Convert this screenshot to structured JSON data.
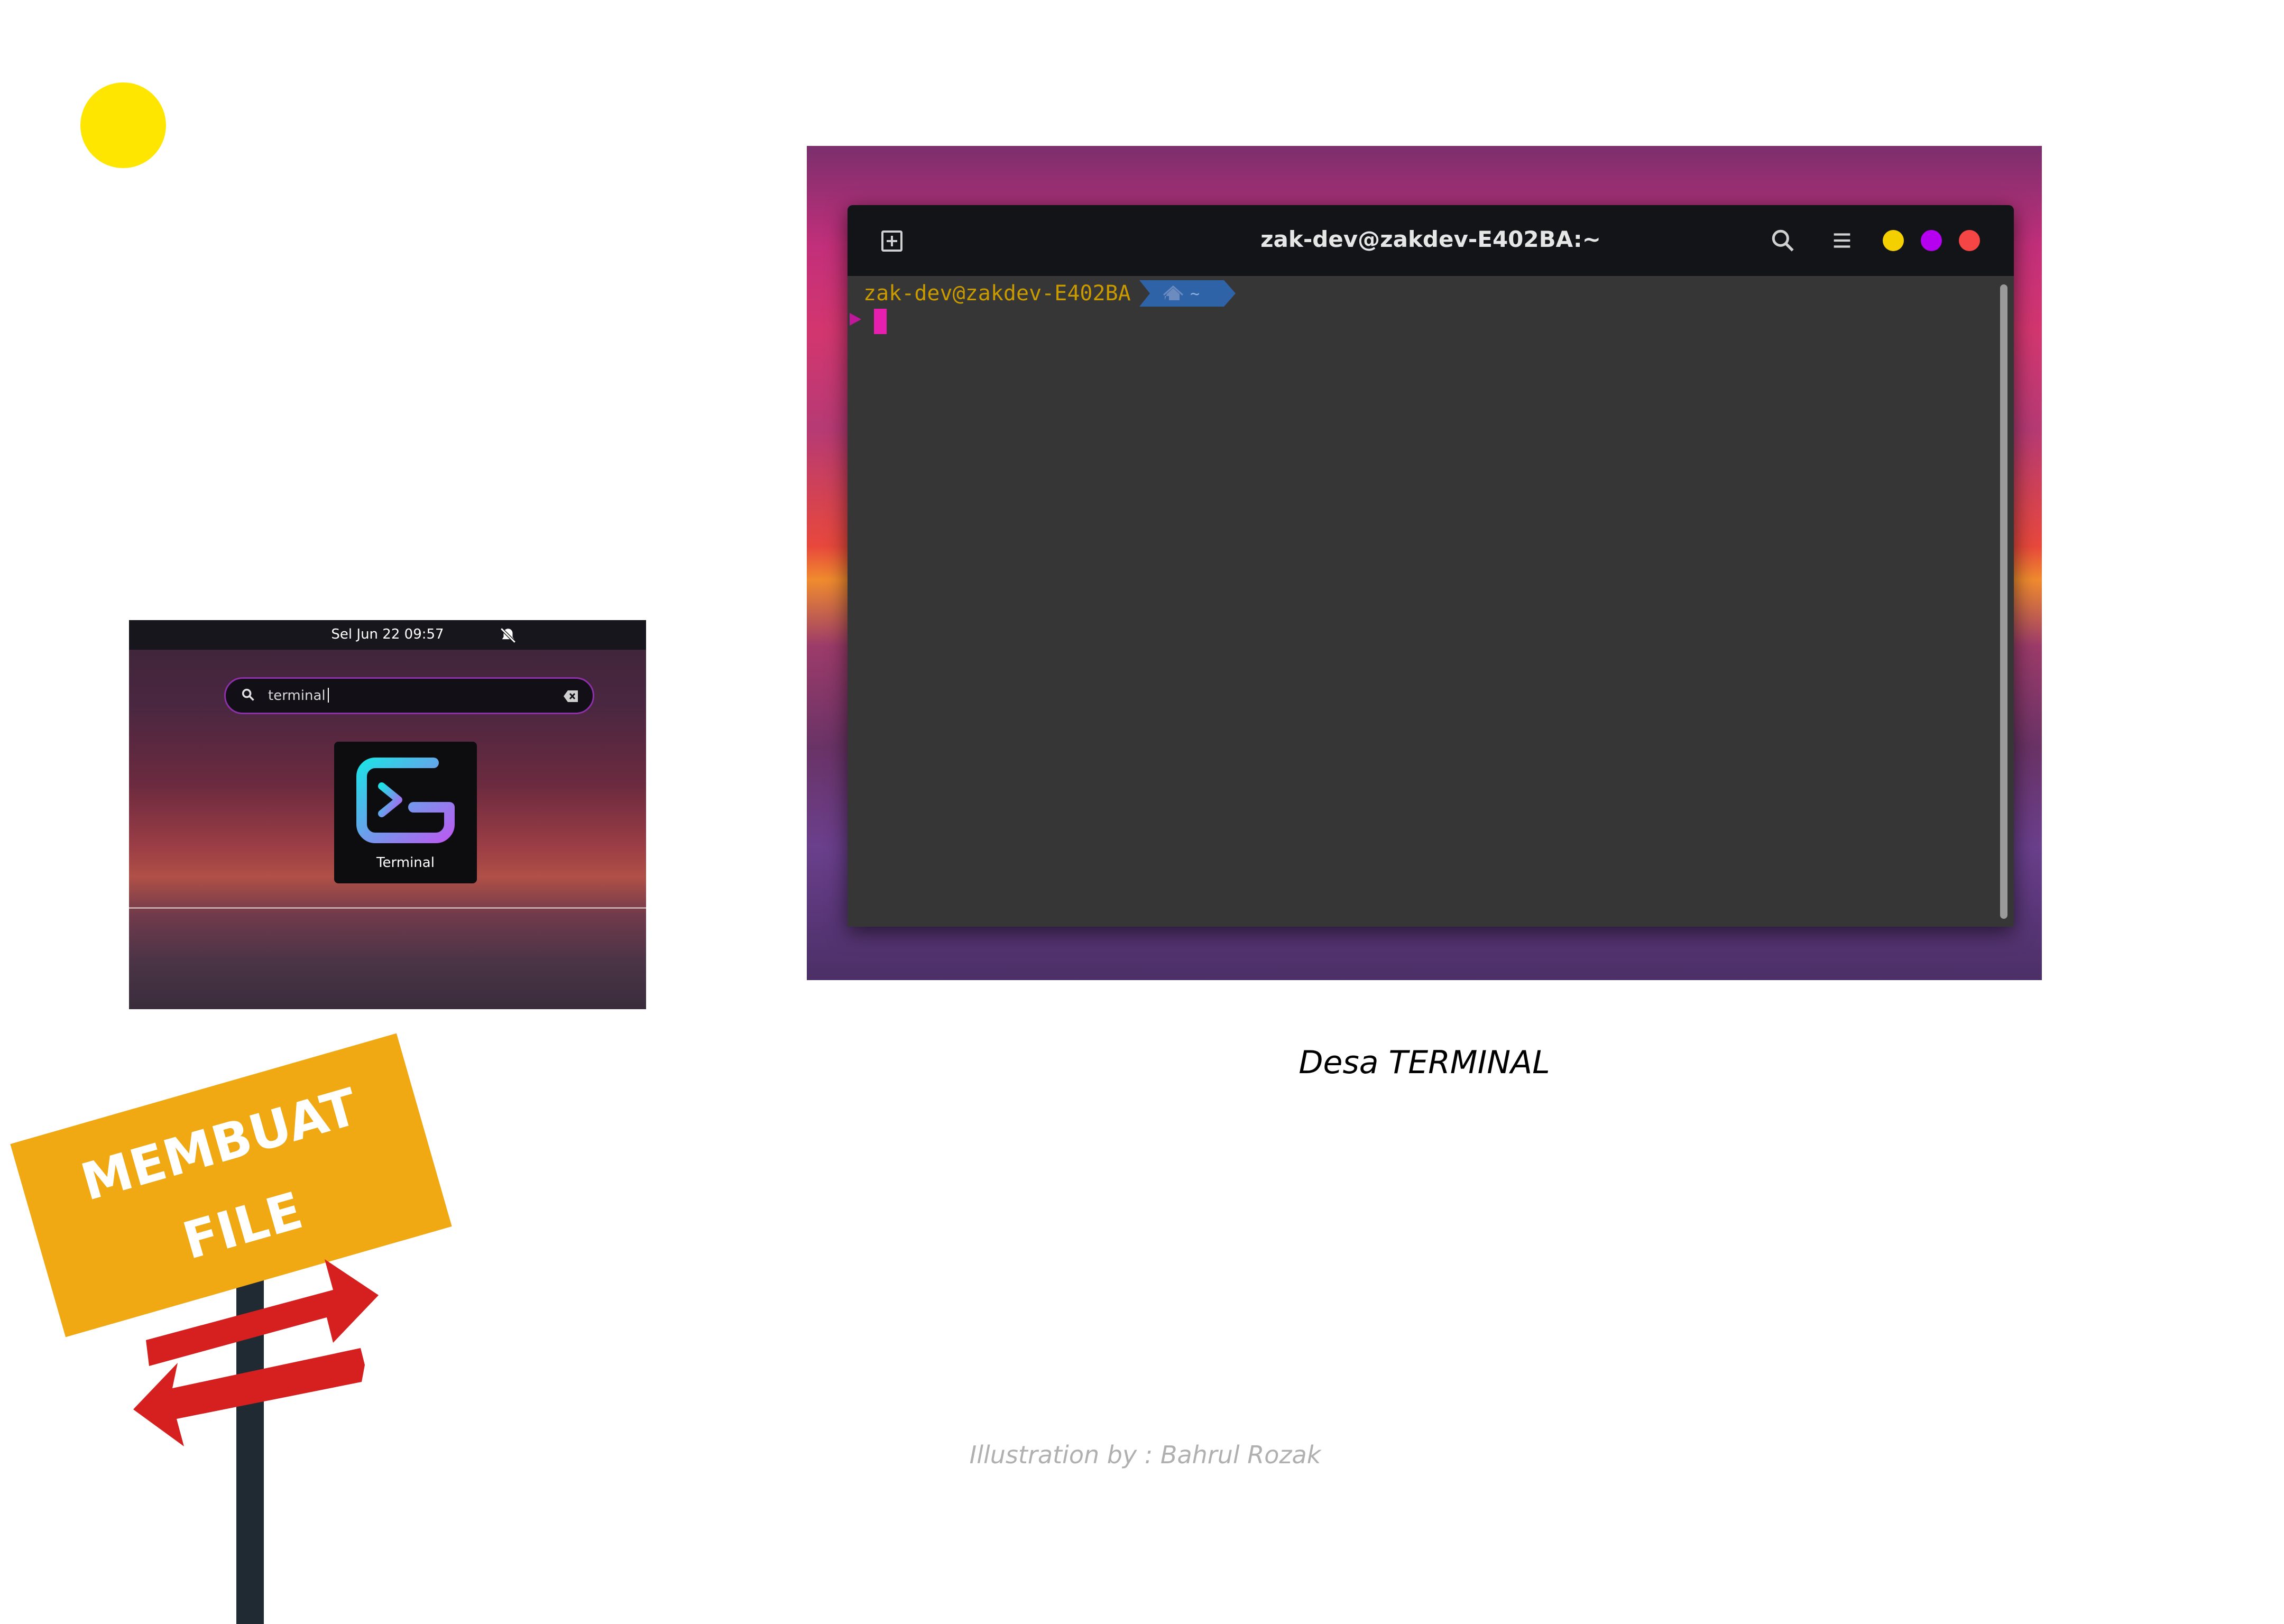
{
  "launcher": {
    "clock": "Sel Jun 22  09:57",
    "search_value": "terminal",
    "app_label": "Terminal"
  },
  "sign": {
    "text": "MEMBUAT\nFILE"
  },
  "terminal": {
    "title": "zak-dev@zakdev-E402BA:~",
    "prompt_user": "zak-dev@zakdev-E402BA",
    "prompt_dir": "~",
    "dot_colors": {
      "minimize": "#f5d000",
      "maximize": "#b600f0",
      "close": "#f54545"
    },
    "accent_cursor": "#e61fae"
  },
  "caption": "Desa TERMINAL",
  "credit": "Illustration by : Bahrul Rozak"
}
